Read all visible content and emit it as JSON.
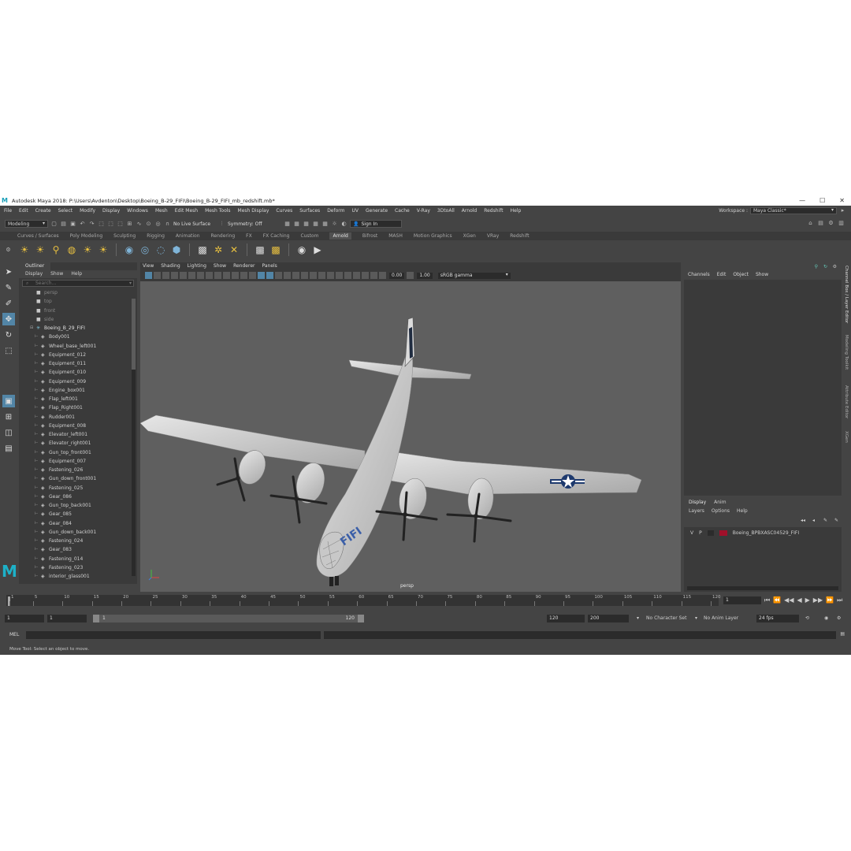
{
  "title": "Autodesk Maya 2018: P:\\Users\\Avdenton\\Desktop\\Boeing_B-29_FIFI\\Boeing_B-29_FIFI_mb_redshift.mb*",
  "window_controls": [
    "—",
    "☐",
    "✕"
  ],
  "menubar": [
    "File",
    "Edit",
    "Create",
    "Select",
    "Modify",
    "Display",
    "Windows",
    "Mesh",
    "Edit Mesh",
    "Mesh Tools",
    "Mesh Display",
    "Curves",
    "Surfaces",
    "Deform",
    "UV",
    "Generate",
    "Cache",
    "V-Ray",
    "3DtoAll",
    "Arnold",
    "Redshift",
    "Help"
  ],
  "workspace": {
    "label": "Workspace :",
    "value": "Maya Classic*"
  },
  "statusline": {
    "mode": "Modeling",
    "live_surface": "No Live Surface",
    "symmetry": "Symmetry: Off",
    "sign_in": "Sign In"
  },
  "shelf_tabs": [
    "Curves / Surfaces",
    "Poly Modeling",
    "Sculpting",
    "Rigging",
    "Animation",
    "Rendering",
    "FX",
    "FX Caching",
    "Custom",
    "Arnold",
    "Bifrost",
    "MASH",
    "Motion Graphics",
    "XGen",
    "VRay",
    "Redshift"
  ],
  "shelf_active": "Arnold",
  "outliner": {
    "title": "Outliner",
    "menu": [
      "Display",
      "Show",
      "Help"
    ],
    "search_placeholder": "Search...",
    "cameras": [
      "persp",
      "top",
      "front",
      "side"
    ],
    "group": "Boeing_B_29_FIFI",
    "items": [
      "Body001",
      "Wheel_base_left001",
      "Equipment_012",
      "Equipment_011",
      "Equipment_010",
      "Equipment_009",
      "Engine_box001",
      "Flap_left001",
      "Flap_Right001",
      "Rudder001",
      "Equipment_008",
      "Elevator_left001",
      "Elevator_right001",
      "Gun_top_front001",
      "Equipment_007",
      "Fastening_026",
      "Gun_down_front001",
      "Fastening_025",
      "Gear_086",
      "Gun_top_back001",
      "Gear_085",
      "Gear_084",
      "Gun_down_back001",
      "Fastening_024",
      "Gear_083",
      "Fastening_014",
      "Fastening_023",
      "interior_glass001"
    ]
  },
  "viewport": {
    "menu": [
      "View",
      "Shading",
      "Lighting",
      "Show",
      "Renderer",
      "Panels"
    ],
    "exposure": "0.00",
    "gamma": "1.00",
    "color_space": "sRGB gamma",
    "camera_label": "persp"
  },
  "channel_box": {
    "menu": [
      "Channels",
      "Edit",
      "Object",
      "Show"
    ]
  },
  "layer_editor": {
    "tabs": [
      "Display",
      "Anim"
    ],
    "menu": [
      "Layers",
      "Options",
      "Help"
    ],
    "layer": {
      "v": "V",
      "p": "P",
      "name": "Boeing_BPBXASC04529_FIFI",
      "color": "#a0102a"
    }
  },
  "side_tabs": [
    "Channel Box / Layer Editor",
    "Modeling Toolkit",
    "Attribute Editor",
    "XGen"
  ],
  "timeline": {
    "ticks": [
      "1",
      "5",
      "10",
      "15",
      "20",
      "25",
      "30",
      "35",
      "40",
      "45",
      "50",
      "55",
      "60",
      "65",
      "70",
      "75",
      "80",
      "85",
      "90",
      "95",
      "100",
      "105",
      "110",
      "115",
      "120"
    ],
    "current_frame": "1",
    "playback": [
      "⏮",
      "⏪",
      "◀◀",
      "◀",
      "▶",
      "▶▶",
      "⏩",
      "⏭"
    ]
  },
  "range": {
    "start": "1",
    "start2": "1",
    "bar_start": "1",
    "bar_end": "120",
    "end": "120",
    "end2": "200",
    "char_set": "No Character Set",
    "anim_layer": "No Anim Layer",
    "fps": "24 fps"
  },
  "command": {
    "label": "MEL"
  },
  "help_line": "Move Tool: Select an object to move."
}
